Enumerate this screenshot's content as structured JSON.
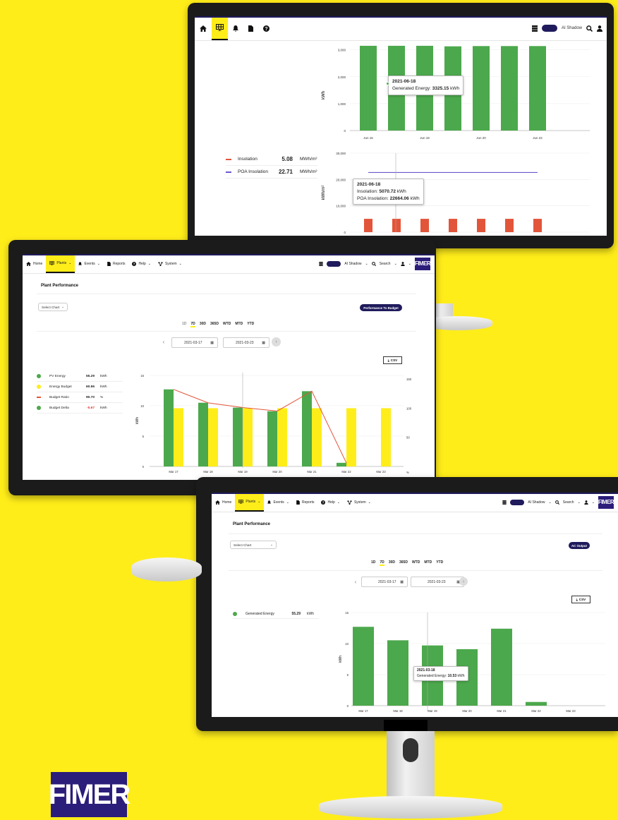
{
  "brand": {
    "logo_text": "FIMER",
    "logo_color": "#2B1D7A",
    "accent": "#FFED1A",
    "navy": "#1F1B5C",
    "green": "#4CA84C",
    "yellow": "#FFED1A",
    "red": "#E2553A",
    "purple": "#6A5ACD"
  },
  "monitor_top": {
    "user_label": "AI Shadow",
    "chart1": {
      "y_label": "kWh",
      "y_ticks": [
        "3,000",
        "2,000",
        "1,000",
        "0"
      ],
      "x_ticks": [
        "Jun 16",
        "Jun 18",
        "Jun 20",
        "Jun 22"
      ]
    },
    "tooltip1": {
      "date": "2021-06-18",
      "label": "Generated Energy:",
      "value": "3325.15",
      "unit": "kWh"
    },
    "legend": [
      {
        "label": "Insolation",
        "value": "5.08",
        "unit": "MWh/m²",
        "color": "#E2553A"
      },
      {
        "label": "POA Insolation",
        "value": "22.71",
        "unit": "MWh/m²",
        "color": "#6A5ACD"
      }
    ],
    "chart2": {
      "y_label": "kWh/m²",
      "y_ticks": [
        "30,000",
        "20,000",
        "10,000",
        "0"
      ]
    },
    "tooltip2": {
      "date": "2021-06-18",
      "line1_label": "Insolation:",
      "line1_value": "5070.72",
      "line1_unit": "kWh",
      "line2_label": "POA Insolation:",
      "line2_value": "22664.06",
      "line2_unit": "kWh"
    }
  },
  "nav": {
    "home": "Home",
    "plants": "Plants",
    "events": "Events",
    "reports": "Reports",
    "help": "Help",
    "system": "System",
    "user": "AI Shadow",
    "search": "Search",
    "brand": "FIMER"
  },
  "monitor_mid": {
    "page_title": "Plant Performance",
    "select_chart": "Select Chart",
    "badge": "Performance To Budget",
    "ranges": [
      "1D",
      "7D",
      "30D",
      "365D",
      "WTD",
      "MTD",
      "YTD"
    ],
    "selected_range": "7D",
    "date_from": "2021-03-17",
    "date_to": "2021-03-23",
    "csv": "CSV",
    "legend": [
      {
        "label": "PV Energy",
        "value": "55.29",
        "unit": "kWh",
        "color": "#4CA84C",
        "shape": "dot"
      },
      {
        "label": "Energy Budget",
        "value": "60.96",
        "unit": "kWh",
        "color": "#FFED1A",
        "shape": "dot"
      },
      {
        "label": "Budget Ratio",
        "value": "90.70",
        "unit": "%",
        "color": "#E2553A",
        "shape": "dash"
      },
      {
        "label": "Budget Delta",
        "value": "-5.67",
        "unit": "kWh",
        "color": "#4CA84C",
        "shape": "dot",
        "negative": true
      }
    ],
    "y_label": "kWh",
    "y2_label": "%"
  },
  "monitor_bot": {
    "page_title": "Plant Performance",
    "select_chart": "Select Chart",
    "badge": "AC Output",
    "ranges": [
      "1D",
      "7D",
      "30D",
      "365D",
      "WTD",
      "MTD",
      "YTD"
    ],
    "selected_range": "7D",
    "date_from": "2021-03-17",
    "date_to": "2021-03-23",
    "csv": "CSV",
    "legend": [
      {
        "label": "Generated Energy",
        "value": "55.29",
        "unit": "kWh",
        "color": "#4CA84C"
      }
    ],
    "y_label": "kWh",
    "tooltip": {
      "date": "2021-03-18",
      "label": "Generated Energy:",
      "value": "10.53",
      "unit": "kWh"
    }
  },
  "chart_data": [
    {
      "type": "bar",
      "ylabel": "kWh",
      "x": [
        "Jun 16",
        "Jun 17",
        "Jun 18",
        "Jun 19",
        "Jun 20",
        "Jun 21",
        "Jun 22"
      ],
      "x_ticks": [
        "Jun 16",
        "Jun 18",
        "Jun 20",
        "Jun 22"
      ],
      "series": [
        {
          "values": [
            3150,
            3150,
            3150,
            3130,
            3140,
            3140,
            3140
          ],
          "color": "#4CA84C"
        }
      ],
      "y_ticks": [
        0,
        1000,
        2000,
        3000
      ],
      "ylim": [
        0,
        3200
      ]
    },
    {
      "type": "bar",
      "ylabel": "kWh/m²",
      "x": [
        "Jun 16",
        "Jun 17",
        "Jun 18",
        "Jun 19",
        "Jun 20",
        "Jun 21",
        "Jun 22"
      ],
      "series": [
        {
          "name": "Insolation",
          "type": "bar",
          "values": [
            5070,
            5070,
            5070,
            5070,
            5070,
            5070,
            5070
          ],
          "color": "#E2553A"
        },
        {
          "name": "POA Insolation",
          "type": "line",
          "values": [
            22664,
            22664,
            22664,
            22664,
            22664,
            22664,
            22664
          ],
          "color": "#6A5ACD"
        }
      ],
      "y_ticks": [
        0,
        10000,
        20000,
        30000
      ],
      "ylim": [
        0,
        30000
      ]
    },
    {
      "type": "bar",
      "ylabel": "kWh",
      "x": [
        "Mar 17",
        "Mar 18",
        "Mar 19",
        "Mar 20",
        "Mar 21",
        "Mar 22",
        "Mar 23"
      ],
      "series": [
        {
          "name": "PV Energy",
          "type": "bar",
          "values": [
            12.7,
            10.5,
            9.7,
            9.1,
            12.4,
            0.6,
            0
          ],
          "color": "#4CA84C"
        },
        {
          "name": "Energy Budget",
          "type": "bar",
          "values": [
            9.6,
            9.6,
            9.6,
            9.6,
            9.6,
            9.6,
            9.6
          ],
          "color": "#FFED1A"
        },
        {
          "name": "Budget Ratio",
          "type": "line",
          "axis": "right",
          "values": [
            132,
            109,
            101,
            95,
            129,
            6,
            null
          ],
          "color": "#E2553A"
        }
      ],
      "y_ticks": [
        0,
        5,
        10,
        15
      ],
      "ylim": [
        0,
        15
      ],
      "y2_ticks": [
        50,
        100,
        150
      ],
      "y2lim": [
        0,
        156
      ]
    },
    {
      "type": "bar",
      "ylabel": "kWh",
      "x": [
        "Mar 17",
        "Mar 18",
        "Mar 19",
        "Mar 20",
        "Mar 21",
        "Mar 22",
        "Mar 23"
      ],
      "series": [
        {
          "name": "Generated Energy",
          "values": [
            12.7,
            10.53,
            9.7,
            9.1,
            12.4,
            0.6,
            0
          ],
          "color": "#4CA84C"
        }
      ],
      "y_ticks": [
        0,
        5,
        10,
        15
      ],
      "ylim": [
        0,
        15
      ]
    }
  ]
}
